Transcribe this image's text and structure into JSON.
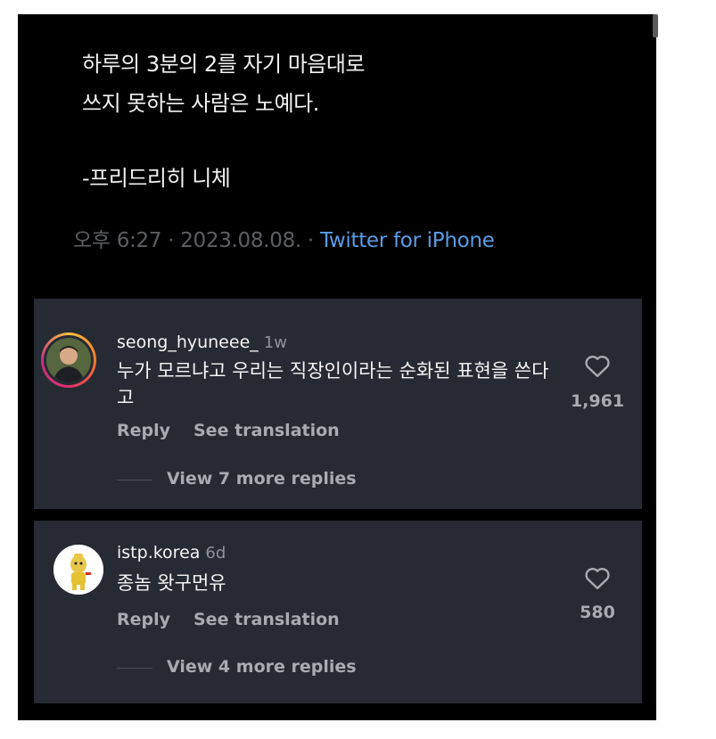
{
  "tweet": {
    "lines": [
      "하루의 3분의 2를 자기 마음대로",
      "쓰지 못하는 사람은 노예다.",
      "-프리드리히 니체"
    ],
    "time": "오후 6:27 · 2023.08.08. · ",
    "source": "Twitter for iPhone"
  },
  "comments": [
    {
      "username": "seong_hyuneee_",
      "age": "1w",
      "text": "누가 모르냐고 우리는 직장인이라는 순화된 표현을 쓴다고",
      "reply": "Reply",
      "translate": "See translation",
      "view_replies": "View 7 more replies",
      "likes": "1,961"
    },
    {
      "username": "istp.korea",
      "age": "6d",
      "text": "종놈 왓구먼유",
      "reply": "Reply",
      "translate": "See translation",
      "view_replies": "View 4 more replies",
      "likes": "580"
    }
  ],
  "colors": {
    "background": "#000000",
    "card": "#262a32",
    "link": "#5b9ce6",
    "muted": "#a7abb2"
  }
}
